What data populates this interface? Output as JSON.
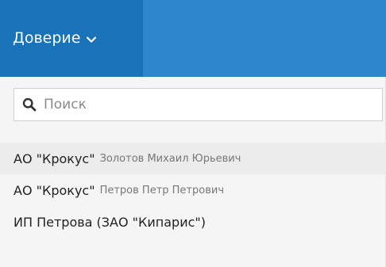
{
  "header": {
    "account_label": "Доверие",
    "chevron_icon": "chevron-down-icon",
    "colors": {
      "bar": "#1a73b9",
      "bar_right": "#2d87cd"
    }
  },
  "search": {
    "icon": "search-icon",
    "value": "",
    "placeholder": "Поиск"
  },
  "organizations": [
    {
      "name": "АО \"Крокус\"",
      "contact": "Золотов Михаил Юрьевич",
      "selected": true
    },
    {
      "name": "АО \"Крокус\"",
      "contact": "Петров Петр Петрович",
      "selected": false
    },
    {
      "name": "ИП Петрова (ЗАО \"Кипарис\")",
      "contact": "",
      "selected": false
    }
  ]
}
